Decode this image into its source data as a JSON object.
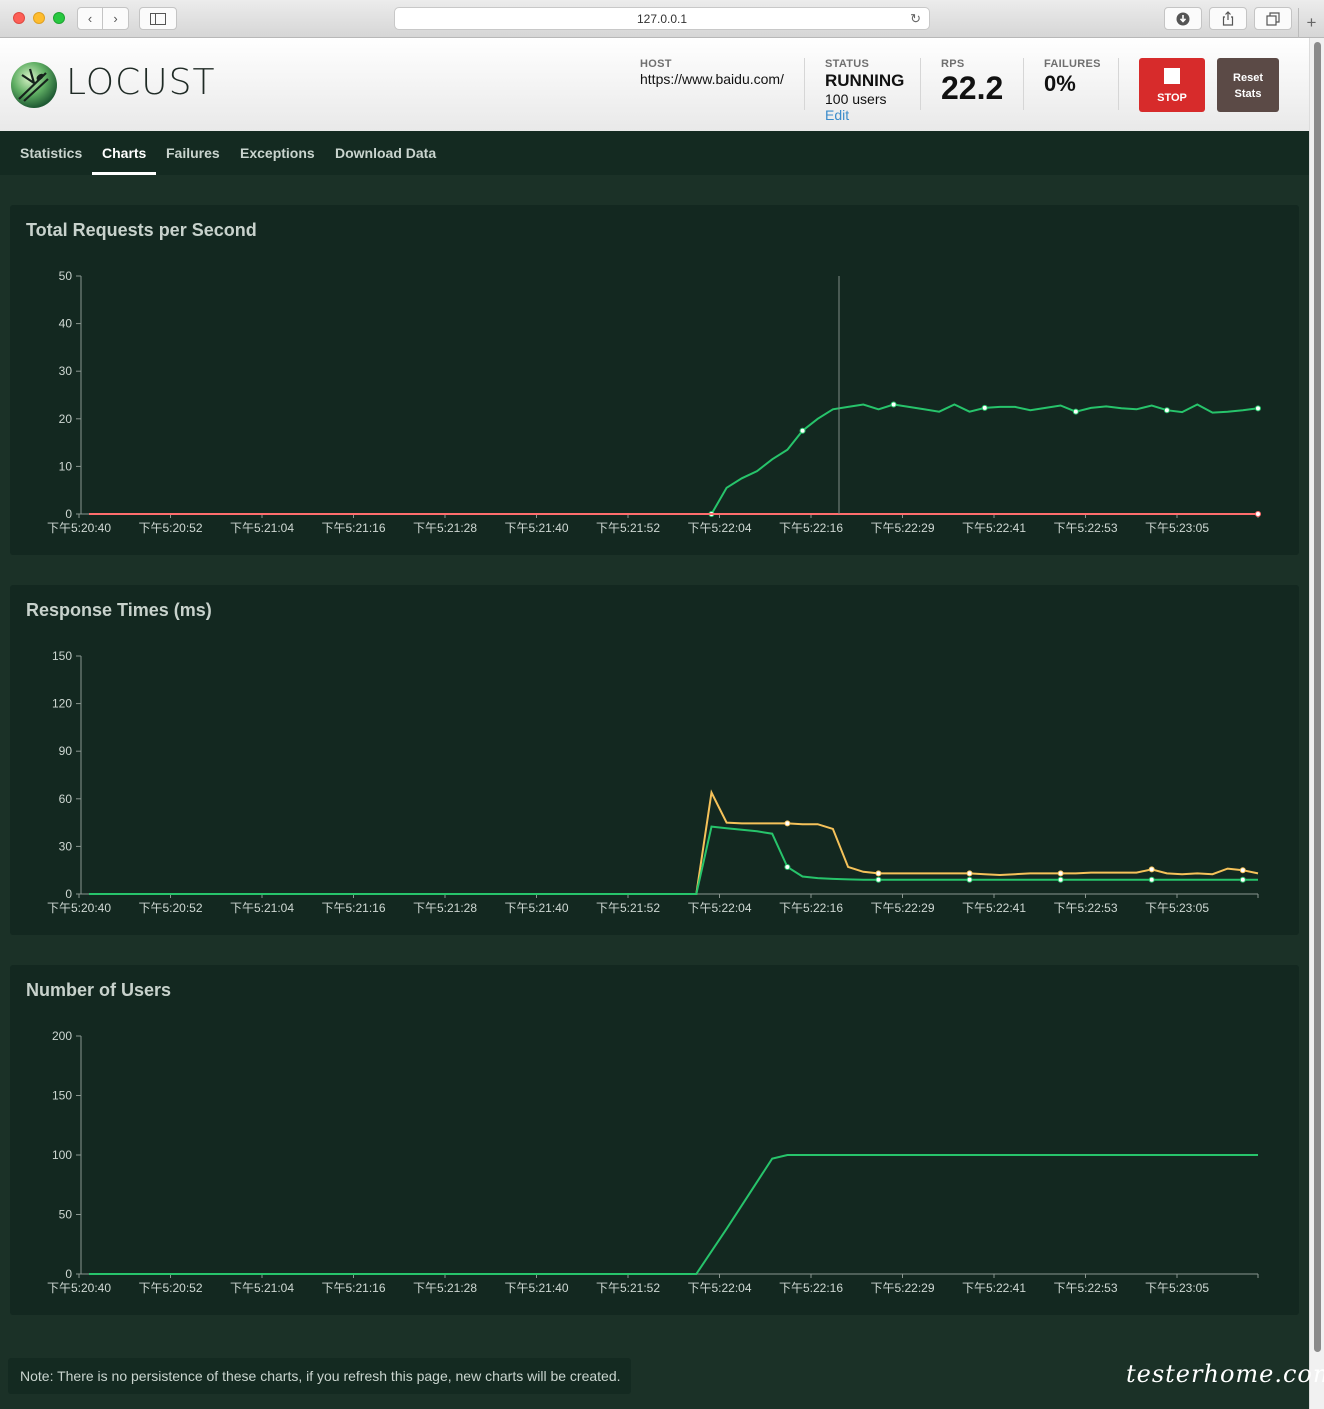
{
  "browser": {
    "address": "127.0.0.1",
    "back_icon": "chevron-left-icon",
    "forward_icon": "chevron-right-icon",
    "sidebar_icon": "sidebar-icon",
    "reload_icon": "reload-icon",
    "download_icon": "download-icon",
    "share_icon": "share-icon",
    "tabs_icon": "tabs-icon",
    "new_tab_icon": "plus-icon"
  },
  "header": {
    "logo_text": "LOCUST",
    "host_label": "HOST",
    "host_value": "https://www.baidu.com/",
    "status_label": "STATUS",
    "status_value": "RUNNING",
    "users_value": "100 users",
    "edit_label": "Edit",
    "rps_label": "RPS",
    "rps_value": "22.2",
    "failures_label": "FAILURES",
    "failures_value": "0%",
    "stop_label": "STOP",
    "reset_label_line1": "Reset",
    "reset_label_line2": "Stats"
  },
  "tabs": [
    {
      "label": "Statistics"
    },
    {
      "label": "Charts",
      "active": true
    },
    {
      "label": "Failures"
    },
    {
      "label": "Exceptions"
    },
    {
      "label": "Download Data"
    }
  ],
  "colors": {
    "page_bg": "#1b3127",
    "panel_bg": "#132820",
    "green_series": "#27c46b",
    "orange_series": "#f5c25a",
    "red_series": "#ff6d6d",
    "stop_button": "#d72b2b",
    "reset_button": "#5b4a46"
  },
  "chart_data": [
    {
      "type": "line",
      "title": "Total Requests per Second",
      "x": [
        "下午5:20:40",
        "下午5:20:52",
        "下午5:21:04",
        "下午5:21:16",
        "下午5:21:28",
        "下午5:21:40",
        "下午5:21:52",
        "下午5:22:04",
        "下午5:22:16",
        "下午5:22:29",
        "下午5:22:41",
        "下午5:22:53",
        "下午5:23:05"
      ],
      "ylim": [
        0,
        50
      ],
      "yticks": [
        0,
        10,
        20,
        30,
        40,
        50
      ],
      "grid": false,
      "series": [
        {
          "color": "#27c46b",
          "points": [
            [
              0,
              0
            ],
            [
              82,
              0
            ],
            [
              84,
              5.5
            ],
            [
              86,
              7.5
            ],
            [
              88,
              9
            ],
            [
              90,
              11.5
            ],
            [
              92,
              13.5
            ],
            [
              94,
              17.5
            ],
            [
              96,
              20
            ],
            [
              98,
              22
            ],
            [
              100,
              22.5
            ],
            [
              102,
              23
            ],
            [
              104,
              22
            ],
            [
              106,
              23
            ],
            [
              108,
              22.5
            ],
            [
              110,
              22
            ],
            [
              112,
              21.5
            ],
            [
              114,
              23
            ],
            [
              116,
              21.5
            ],
            [
              118,
              22.3
            ],
            [
              120,
              22.5
            ],
            [
              122,
              22.5
            ],
            [
              124,
              21.8
            ],
            [
              126,
              22.3
            ],
            [
              128,
              22.8
            ],
            [
              130,
              21.5
            ],
            [
              132,
              22.3
            ],
            [
              134,
              22.6
            ],
            [
              136,
              22.2
            ],
            [
              138,
              22
            ],
            [
              140,
              22.8
            ],
            [
              142,
              21.8
            ],
            [
              144,
              21.4
            ],
            [
              146,
              23
            ],
            [
              148,
              21.3
            ],
            [
              150,
              21.5
            ],
            [
              152,
              21.8
            ],
            [
              154,
              22.2
            ]
          ]
        },
        {
          "color": "#ff6d6d",
          "points": [
            [
              0,
              0
            ],
            [
              154,
              0
            ]
          ]
        }
      ]
    },
    {
      "type": "line",
      "title": "Response Times (ms)",
      "x": [
        "下午5:20:40",
        "下午5:20:52",
        "下午5:21:04",
        "下午5:21:16",
        "下午5:21:28",
        "下午5:21:40",
        "下午5:21:52",
        "下午5:22:04",
        "下午5:22:16",
        "下午5:22:29",
        "下午5:22:41",
        "下午5:22:53",
        "下午5:23:05"
      ],
      "ylim": [
        0,
        150
      ],
      "yticks": [
        0,
        30,
        60,
        90,
        120,
        150
      ],
      "grid": false,
      "series": [
        {
          "color": "#f5c25a",
          "points": [
            [
              0,
              0
            ],
            [
              80,
              0
            ],
            [
              82,
              64
            ],
            [
              84,
              45
            ],
            [
              86,
              44.5
            ],
            [
              88,
              44.5
            ],
            [
              90,
              44.5
            ],
            [
              92,
              44.5
            ],
            [
              94,
              44
            ],
            [
              96,
              44
            ],
            [
              98,
              41
            ],
            [
              100,
              17
            ],
            [
              102,
              14
            ],
            [
              104,
              13
            ],
            [
              106,
              13
            ],
            [
              108,
              13
            ],
            [
              110,
              13
            ],
            [
              112,
              13
            ],
            [
              114,
              13
            ],
            [
              116,
              13
            ],
            [
              118,
              12.5
            ],
            [
              120,
              12
            ],
            [
              122,
              12.5
            ],
            [
              124,
              13
            ],
            [
              126,
              13
            ],
            [
              128,
              13
            ],
            [
              130,
              13
            ],
            [
              132,
              13.5
            ],
            [
              134,
              13.5
            ],
            [
              136,
              13.5
            ],
            [
              138,
              13.5
            ],
            [
              140,
              15.5
            ],
            [
              142,
              13
            ],
            [
              144,
              12.5
            ],
            [
              146,
              13
            ],
            [
              148,
              12.5
            ],
            [
              150,
              16
            ],
            [
              152,
              15
            ],
            [
              154,
              13
            ]
          ]
        },
        {
          "color": "#27c46b",
          "points": [
            [
              0,
              0
            ],
            [
              80,
              0
            ],
            [
              82,
              42.5
            ],
            [
              84,
              41.5
            ],
            [
              86,
              40.5
            ],
            [
              88,
              39.5
            ],
            [
              90,
              38
            ],
            [
              92,
              17
            ],
            [
              94,
              11
            ],
            [
              96,
              10
            ],
            [
              98,
              9.5
            ],
            [
              100,
              9.2
            ],
            [
              102,
              9
            ],
            [
              104,
              9
            ],
            [
              106,
              9
            ],
            [
              108,
              9
            ],
            [
              110,
              9
            ],
            [
              112,
              9
            ],
            [
              114,
              9
            ],
            [
              116,
              9
            ],
            [
              118,
              9
            ],
            [
              120,
              9
            ],
            [
              122,
              9
            ],
            [
              124,
              9
            ],
            [
              126,
              9
            ],
            [
              128,
              9
            ],
            [
              130,
              9
            ],
            [
              132,
              9
            ],
            [
              134,
              9
            ],
            [
              136,
              9
            ],
            [
              138,
              9
            ],
            [
              140,
              9
            ],
            [
              142,
              9
            ],
            [
              144,
              9
            ],
            [
              146,
              9
            ],
            [
              148,
              9
            ],
            [
              150,
              9
            ],
            [
              152,
              9
            ],
            [
              154,
              9
            ]
          ]
        }
      ]
    },
    {
      "type": "line",
      "title": "Number of Users",
      "x": [
        "下午5:20:40",
        "下午5:20:52",
        "下午5:21:04",
        "下午5:21:16",
        "下午5:21:28",
        "下午5:21:40",
        "下午5:21:52",
        "下午5:22:04",
        "下午5:22:16",
        "下午5:22:29",
        "下午5:22:41",
        "下午5:22:53",
        "下午5:23:05"
      ],
      "ylim": [
        0,
        200
      ],
      "yticks": [
        0,
        50,
        100,
        150,
        200
      ],
      "grid": false,
      "series": [
        {
          "color": "#27c46b",
          "points": [
            [
              0,
              0
            ],
            [
              80,
              0
            ],
            [
              84,
              38
            ],
            [
              90,
              97
            ],
            [
              92,
              100
            ],
            [
              154,
              100
            ]
          ]
        }
      ]
    }
  ],
  "note": "Note: There is no persistence of these charts, if you refresh this page, new charts will be created.",
  "watermark": "testerhome.com"
}
